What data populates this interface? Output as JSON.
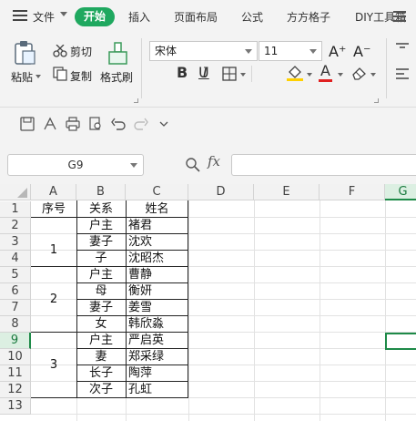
{
  "menubar": {
    "file_label": "文件",
    "tabs": [
      "开始",
      "插入",
      "页面布局",
      "公式",
      "方方格子",
      "DIY工具箱"
    ]
  },
  "ribbon": {
    "paste_label": "粘贴",
    "cut_label": "剪切",
    "copy_label": "复制",
    "format_painter_label": "格式刷",
    "font_name": "宋体",
    "font_size": "11",
    "increase_font_label": "A⁺",
    "decrease_font_label": "A⁻",
    "bold_label": "B",
    "italic_label": "I",
    "underline_label": "U",
    "font_color_letter": "A"
  },
  "colors": {
    "accent": "#1fa85f",
    "selection": "#1e8a48",
    "font_color_bar": "#e02020",
    "fill_color_bar": "#ffd000"
  },
  "formula_bar": {
    "cell_ref": "G9",
    "fx_label": "fx",
    "formula": ""
  },
  "sheet": {
    "columns": [
      "A",
      "B",
      "C",
      "D",
      "E",
      "F",
      "G"
    ],
    "rows": [
      "1",
      "2",
      "3",
      "4",
      "5",
      "6",
      "7",
      "8",
      "9",
      "10",
      "11",
      "12",
      "13"
    ],
    "header": {
      "A": "序号",
      "B": "关系",
      "C": "姓名"
    },
    "groups": [
      "1",
      "2",
      "3"
    ],
    "relations": [
      "户主",
      "妻子",
      "子",
      "户主",
      "母",
      "妻子",
      "女",
      "户主",
      "妻",
      "长子",
      "次子"
    ],
    "names": [
      "褚君",
      "沈欢",
      "沈昭杰",
      "曹静",
      "衡妍",
      "姜雪",
      "韩欣淼",
      "严启英",
      "郑采绿",
      "陶萍",
      "孔虹"
    ],
    "selected_cell": "G9"
  }
}
